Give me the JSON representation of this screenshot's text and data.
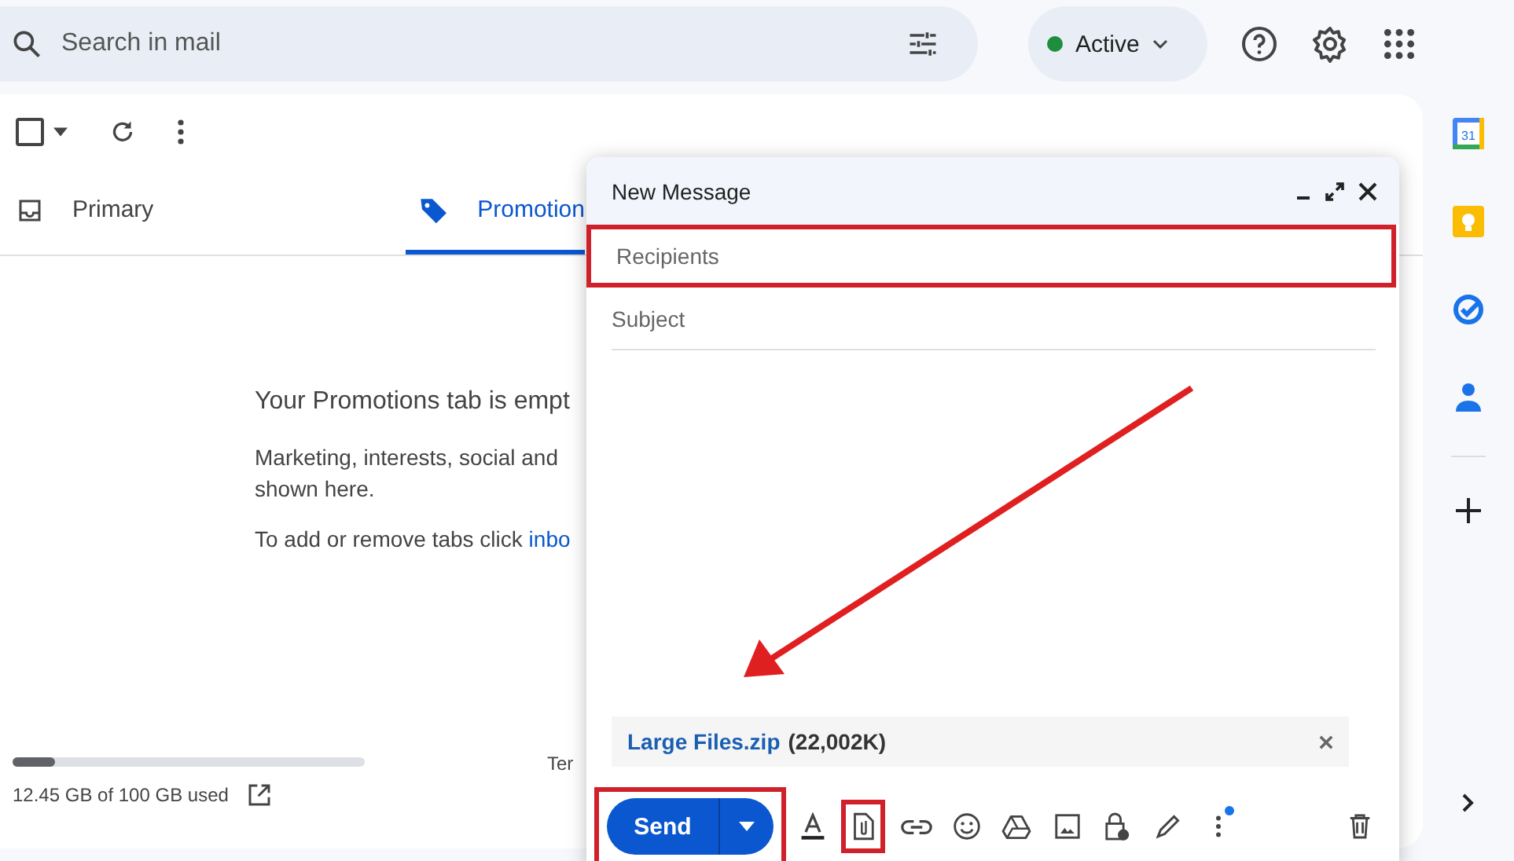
{
  "search": {
    "placeholder": "Search in mail"
  },
  "status": {
    "label": "Active",
    "online": true
  },
  "select_all": {
    "checked": false
  },
  "tabs": [
    {
      "label": "Primary",
      "kind": "inbox",
      "selected": false
    },
    {
      "label": "Promotion",
      "kind": "tag",
      "selected": true
    }
  ],
  "empty_state": {
    "title": "Your Promotions tab is empt",
    "lines": [
      "Marketing, interests, social and",
      "shown here."
    ],
    "hint": "To add or remove tabs click ",
    "link": "inbo"
  },
  "storage": {
    "level": 0.12,
    "text": "12.45 GB of 100 GB used"
  },
  "footer": "Ter",
  "compose": {
    "title": "New Message",
    "recipients": {
      "placeholder": "Recipients",
      "highlighted": true
    },
    "subject": {
      "placeholder": "Subject"
    },
    "pointer_arrow": true,
    "attachment": {
      "name": "Large Files.zip",
      "size": "(22,002K)"
    },
    "send": {
      "label": "Send",
      "highlighted": true
    },
    "tools": [
      {
        "kind": "format",
        "highlighted": false
      },
      {
        "kind": "attach",
        "highlighted": true
      },
      {
        "kind": "link",
        "highlighted": false
      },
      {
        "kind": "emoji",
        "highlighted": false
      },
      {
        "kind": "drive",
        "highlighted": false
      },
      {
        "kind": "image",
        "highlighted": false
      },
      {
        "kind": "lock",
        "highlighted": false
      },
      {
        "kind": "signature",
        "highlighted": false
      },
      {
        "kind": "more",
        "highlighted": false,
        "badge": true
      }
    ]
  },
  "rail": [
    {
      "kind": "calendar",
      "label": "31"
    },
    {
      "kind": "keep"
    },
    {
      "kind": "tasks"
    },
    {
      "kind": "contacts"
    }
  ]
}
